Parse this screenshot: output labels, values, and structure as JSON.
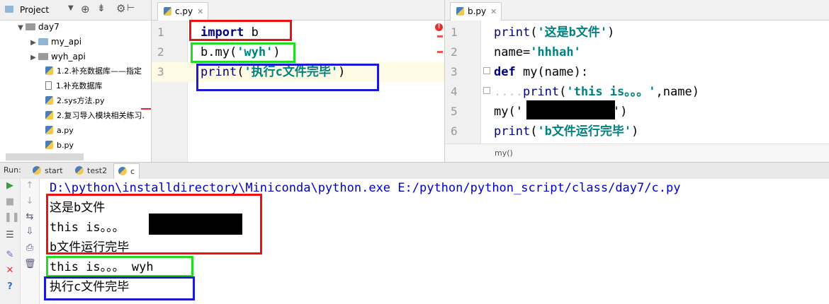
{
  "project": {
    "title": "Project",
    "items": [
      {
        "label": "day7",
        "kind": "folder-grey",
        "depth": 0,
        "expanded": true
      },
      {
        "label": "my_api",
        "kind": "folder",
        "depth": 1
      },
      {
        "label": "wyh_api",
        "kind": "folder-grey",
        "depth": 1
      },
      {
        "label": "1.2.补充数据库——指定",
        "kind": "py",
        "depth": 1
      },
      {
        "label": "1.补充数据库",
        "kind": "txt",
        "depth": 1
      },
      {
        "label": "2.sys方法.py",
        "kind": "py",
        "depth": 1
      },
      {
        "label": "2.复习导入模块相关练习.",
        "kind": "py",
        "depth": 1
      },
      {
        "label": "a.py",
        "kind": "py",
        "depth": 1
      },
      {
        "label": "b.py",
        "kind": "py",
        "depth": 1
      }
    ]
  },
  "editor_left": {
    "tab": "c.py",
    "line_numbers": [
      "1",
      "2",
      "3"
    ],
    "lines": {
      "l1_kw": "import",
      "l1_rest": " b",
      "l2_a": "b.my(",
      "l2_str": "'wyh'",
      "l2_b": ")",
      "l3_fn": "print",
      "l3_a": "(",
      "l3_str": "'执行c文件完毕'",
      "l3_b": ")"
    }
  },
  "editor_right": {
    "tab": "b.py",
    "line_numbers": [
      "1",
      "2",
      "3",
      "4",
      "5",
      "6"
    ],
    "lines": {
      "l1_fn": "print",
      "l1_a": "(",
      "l1_str": "'这是b文件'",
      "l1_b": ")",
      "l2_a": "name=",
      "l2_str": "'hhhah'",
      "l3_kw": "def",
      "l3_rest": " my(name):",
      "l4_dots": "....",
      "l4_fn": "print",
      "l4_a": "(",
      "l4_str": "'this is。。。'",
      "l4_b": ",name)",
      "l5_a": "my('",
      "l5_b": "')",
      "l6_fn": "print",
      "l6_a": "(",
      "l6_str": "'b文件运行完毕'",
      "l6_b": ")"
    },
    "breadcrumb": "my()"
  },
  "run": {
    "label": "Run:",
    "tabs": [
      "start",
      "test2",
      "c"
    ],
    "command": "D:\\python\\installdirectory\\Miniconda\\python.exe E:/python/python_script/class/day7/c.py",
    "output": [
      "这是b文件",
      "this is。。。",
      "b文件运行完毕",
      "this is。。。 wyh",
      "执行c文件完毕"
    ]
  },
  "colors": {
    "highlight_red": "#e11111",
    "highlight_green": "#22dd22",
    "highlight_blue": "#1a1ad6",
    "string": "#008080",
    "keyword": "#000080"
  }
}
